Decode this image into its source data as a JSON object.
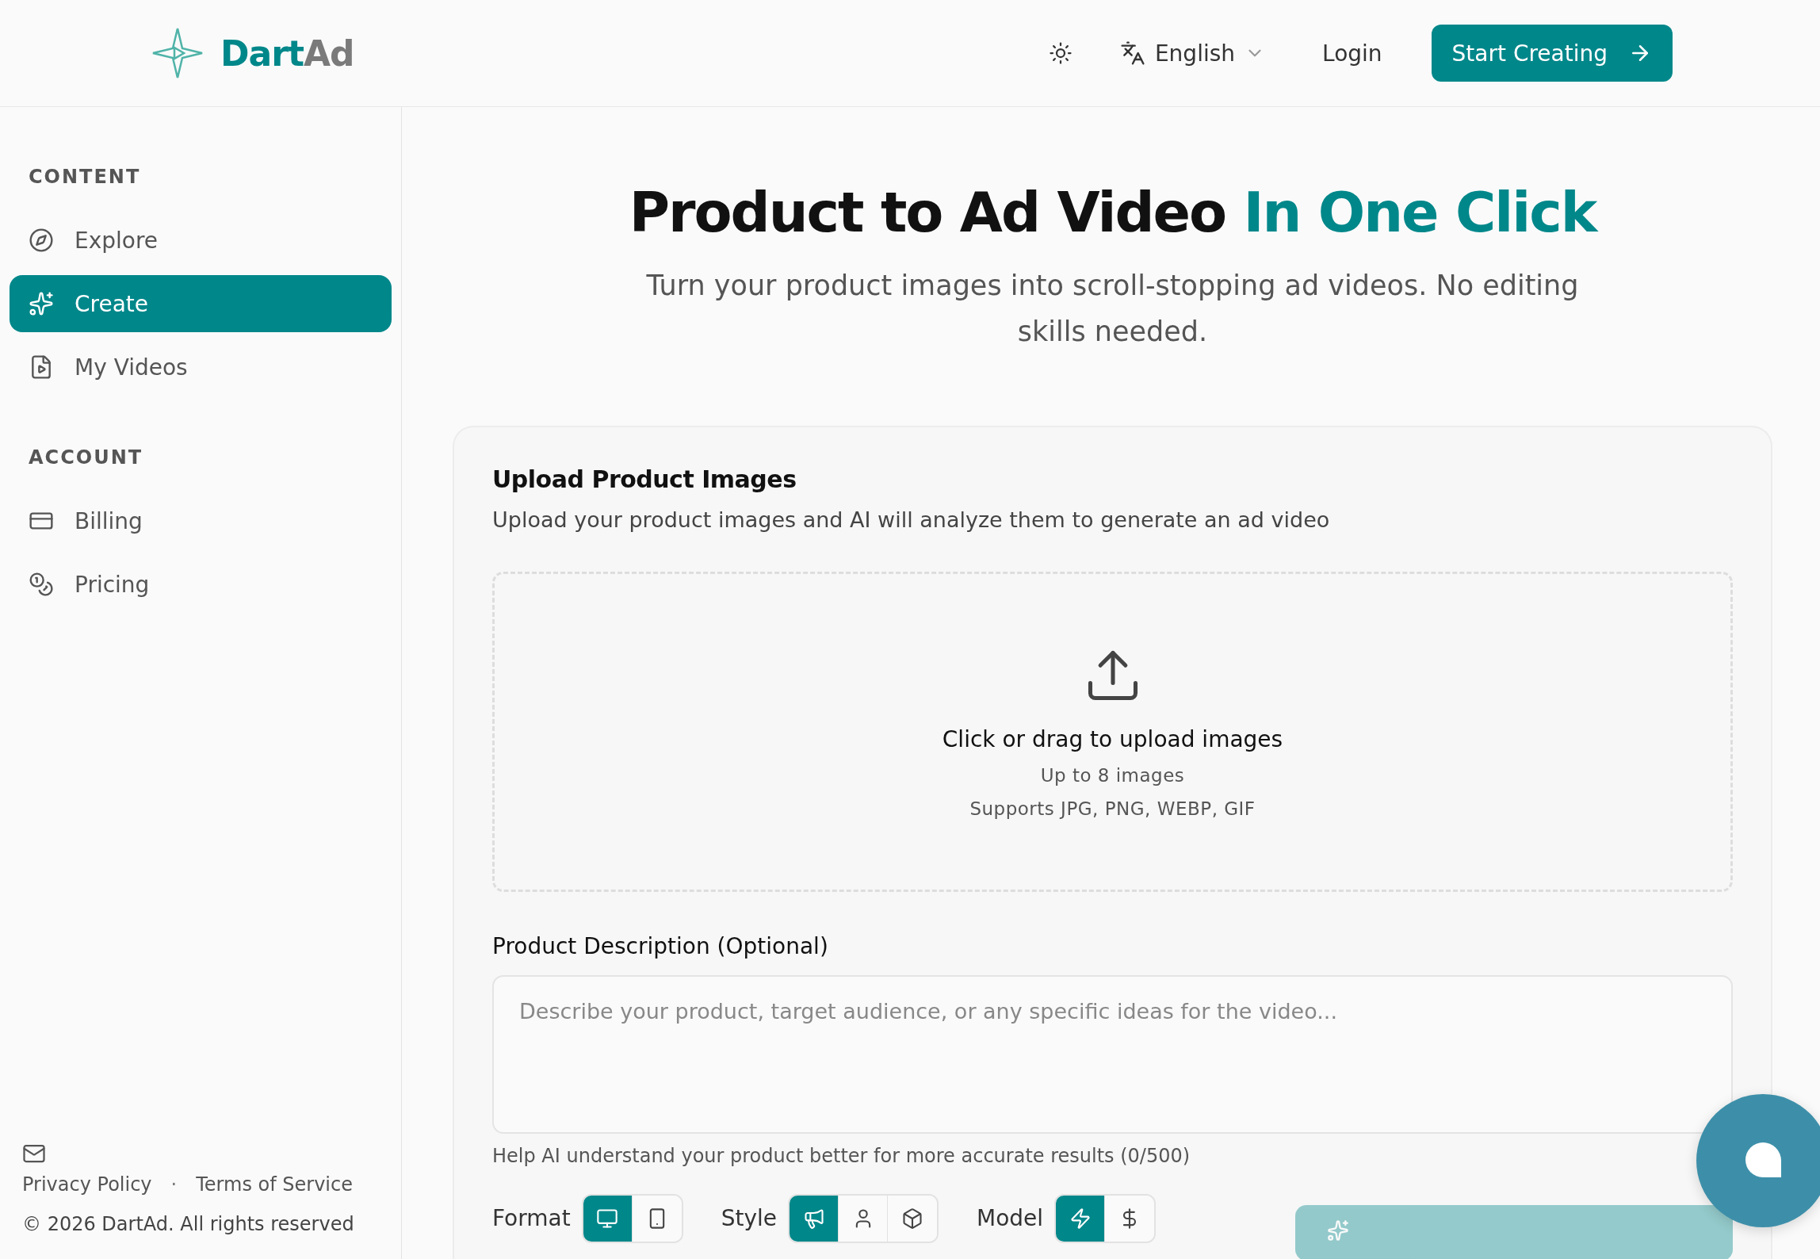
{
  "header": {
    "logo_primary": "Dart",
    "logo_secondary": "Ad",
    "language": "English",
    "login": "Login",
    "cta": "Start Creating"
  },
  "sidebar": {
    "sections": [
      {
        "title": "CONTENT",
        "items": [
          {
            "label": "Explore",
            "kind": "compass",
            "selected": false
          },
          {
            "label": "Create",
            "kind": "sparkles",
            "selected": true
          },
          {
            "label": "My Videos",
            "kind": "video-file",
            "selected": false
          }
        ]
      },
      {
        "title": "ACCOUNT",
        "items": [
          {
            "label": "Billing",
            "kind": "card",
            "selected": false
          },
          {
            "label": "Pricing",
            "kind": "coins",
            "selected": false
          }
        ]
      }
    ],
    "footer": {
      "links": [
        "Privacy Policy",
        "Terms of Service"
      ],
      "separator": "·",
      "copyright": "© 2026 DartAd. All rights reserved"
    }
  },
  "hero": {
    "title": "Product to Ad Video",
    "title_accent": "In One Click",
    "subtitle": "Turn your product images into scroll-stopping ad videos. No editing skills needed."
  },
  "upload": {
    "title": "Upload Product Images",
    "description": "Upload your product images and AI will analyze them to generate an ad video",
    "drop_title": "Click or drag to upload images",
    "drop_limit": "Up to 8 images",
    "drop_formats": "Supports JPG, PNG, WEBP, GIF"
  },
  "description": {
    "label": "Product Description (Optional)",
    "placeholder": "Describe your product, target audience, or any specific ideas for the video...",
    "help": "Help AI understand your product better for more accurate results (0/500)"
  },
  "options": [
    {
      "label": "Format",
      "choices": [
        {
          "kind": "monitor",
          "selected": true
        },
        {
          "kind": "phone",
          "selected": false
        }
      ]
    },
    {
      "label": "Style",
      "choices": [
        {
          "kind": "megaphone",
          "selected": true
        },
        {
          "kind": "person",
          "selected": false
        },
        {
          "kind": "box",
          "selected": false
        }
      ]
    },
    {
      "label": "Model",
      "choices": [
        {
          "kind": "bolt",
          "selected": true
        },
        {
          "kind": "dollar",
          "selected": false
        }
      ]
    }
  ],
  "generate_button": {
    "disabled": true
  }
}
